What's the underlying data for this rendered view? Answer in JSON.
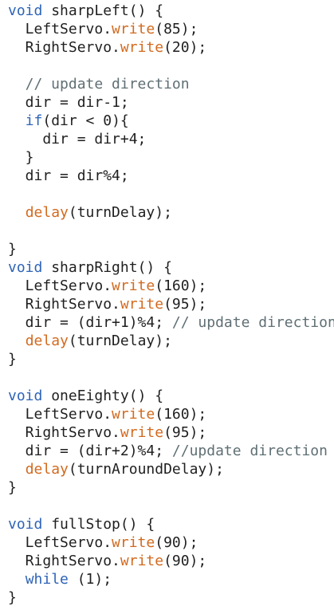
{
  "editor": {
    "lines": [
      [
        {
          "t": "void",
          "c": "kw"
        },
        {
          "t": " sharpLeft() {",
          "c": "tx"
        }
      ],
      [
        {
          "t": "  LeftServo.",
          "c": "tx"
        },
        {
          "t": "write",
          "c": "fn"
        },
        {
          "t": "(85);",
          "c": "tx"
        }
      ],
      [
        {
          "t": "  RightServo.",
          "c": "tx"
        },
        {
          "t": "write",
          "c": "fn"
        },
        {
          "t": "(20);",
          "c": "tx"
        }
      ],
      [],
      [
        {
          "t": "  // update direction",
          "c": "cm"
        }
      ],
      [
        {
          "t": "  dir = dir-1;",
          "c": "tx"
        }
      ],
      [
        {
          "t": "  ",
          "c": "tx"
        },
        {
          "t": "if",
          "c": "kw"
        },
        {
          "t": "(dir < 0){",
          "c": "tx"
        }
      ],
      [
        {
          "t": "    dir = dir+4;",
          "c": "tx"
        }
      ],
      [
        {
          "t": "  }",
          "c": "tx"
        }
      ],
      [
        {
          "t": "  dir = dir%4;",
          "c": "tx"
        }
      ],
      [],
      [
        {
          "t": "  ",
          "c": "tx"
        },
        {
          "t": "delay",
          "c": "fn"
        },
        {
          "t": "(turnDelay);",
          "c": "tx"
        }
      ],
      [],
      [
        {
          "t": "}",
          "c": "tx"
        }
      ],
      [
        {
          "t": "void",
          "c": "kw"
        },
        {
          "t": " sharpRight() {",
          "c": "tx"
        }
      ],
      [
        {
          "t": "  LeftServo.",
          "c": "tx"
        },
        {
          "t": "write",
          "c": "fn"
        },
        {
          "t": "(160);",
          "c": "tx"
        }
      ],
      [
        {
          "t": "  RightServo.",
          "c": "tx"
        },
        {
          "t": "write",
          "c": "fn"
        },
        {
          "t": "(95);",
          "c": "tx"
        }
      ],
      [
        {
          "t": "  dir = (dir+1)%4; ",
          "c": "tx"
        },
        {
          "t": "// update direction",
          "c": "cm"
        }
      ],
      [
        {
          "t": "  ",
          "c": "tx"
        },
        {
          "t": "delay",
          "c": "fn"
        },
        {
          "t": "(turnDelay);",
          "c": "tx"
        }
      ],
      [
        {
          "t": "}",
          "c": "tx"
        }
      ],
      [],
      [
        {
          "t": "void",
          "c": "kw"
        },
        {
          "t": " oneEighty() {",
          "c": "tx"
        }
      ],
      [
        {
          "t": "  LeftServo.",
          "c": "tx"
        },
        {
          "t": "write",
          "c": "fn"
        },
        {
          "t": "(160);",
          "c": "tx"
        }
      ],
      [
        {
          "t": "  RightServo.",
          "c": "tx"
        },
        {
          "t": "write",
          "c": "fn"
        },
        {
          "t": "(95);",
          "c": "tx"
        }
      ],
      [
        {
          "t": "  dir = (dir+2)%4; ",
          "c": "tx"
        },
        {
          "t": "//update direction",
          "c": "cm"
        }
      ],
      [
        {
          "t": "  ",
          "c": "tx"
        },
        {
          "t": "delay",
          "c": "fn"
        },
        {
          "t": "(turnAroundDelay);",
          "c": "tx"
        }
      ],
      [
        {
          "t": "}",
          "c": "tx"
        }
      ],
      [],
      [
        {
          "t": "void",
          "c": "kw"
        },
        {
          "t": " fullStop() {",
          "c": "tx"
        }
      ],
      [
        {
          "t": "  LeftServo.",
          "c": "tx"
        },
        {
          "t": "write",
          "c": "fn"
        },
        {
          "t": "(90);",
          "c": "tx"
        }
      ],
      [
        {
          "t": "  RightServo.",
          "c": "tx"
        },
        {
          "t": "write",
          "c": "fn"
        },
        {
          "t": "(90);",
          "c": "tx"
        }
      ],
      [
        {
          "t": "  ",
          "c": "tx"
        },
        {
          "t": "while",
          "c": "kw"
        },
        {
          "t": " (1);",
          "c": "tx"
        }
      ],
      [
        {
          "t": "}",
          "c": "tx"
        }
      ]
    ]
  },
  "colors": {
    "background": "#ffffff",
    "text": "#1f1f1f",
    "keyword": "#2e64b8",
    "function": "#d26a1f",
    "comment": "#5f6f74"
  }
}
